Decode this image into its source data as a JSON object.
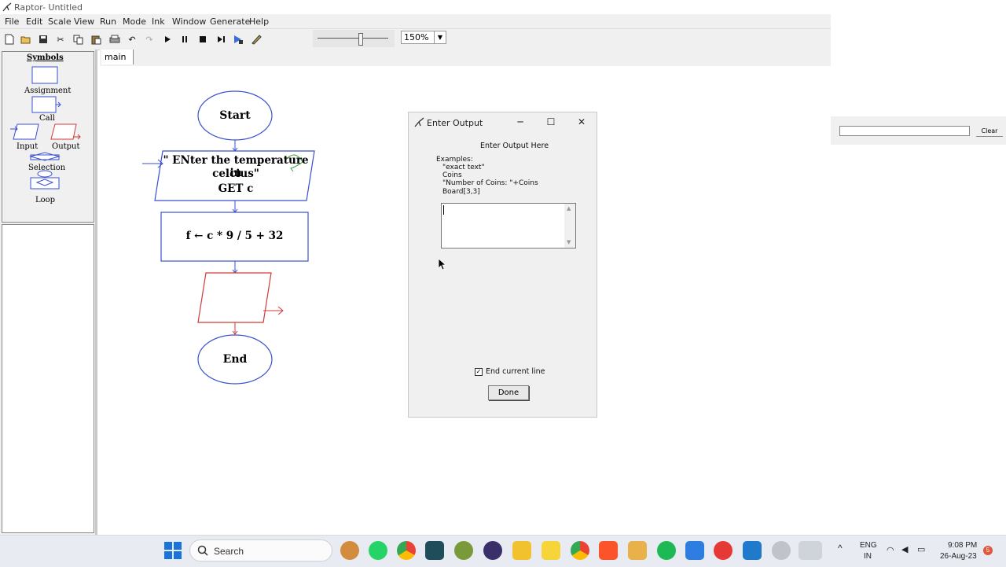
{
  "window": {
    "title": "Raptor- Untitled"
  },
  "menu": [
    "File",
    "Edit",
    "Scale",
    "View",
    "Run",
    "Mode",
    "Ink",
    "Window",
    "Generate",
    "Help"
  ],
  "toolbar": {
    "zoom": "150%"
  },
  "symbols": {
    "header": "Symbols",
    "items": {
      "assignment": "Assignment",
      "call": "Call",
      "input": "Input",
      "output": "Output",
      "selection": "Selection",
      "loop": "Loop"
    }
  },
  "tabs": [
    "main"
  ],
  "flowchart": {
    "start": "Start",
    "input_line1": "\" ENter the temperature in",
    "input_line2": "celcius\"",
    "input_line3": "GET c",
    "assignment": "f ← c * 9 / 5 + 32",
    "end": "End"
  },
  "dialog": {
    "title": "Enter Output",
    "heading": "Enter Output Here",
    "examples_label": "Examples:",
    "examples": [
      "\"exact text\"",
      "Coins",
      "\"Number of Coins: \"+Coins",
      "Board[3,3]"
    ],
    "output_value": "",
    "checkbox_label": "End current line",
    "checkbox_checked": true,
    "done_label": "Done"
  },
  "side_panel": {
    "clear_label": "Clear"
  },
  "taskbar": {
    "search_label": "Search",
    "lang1": "ENG",
    "lang2": "IN",
    "time": "9:08 PM",
    "date": "26-Aug-23",
    "badge": "5"
  }
}
